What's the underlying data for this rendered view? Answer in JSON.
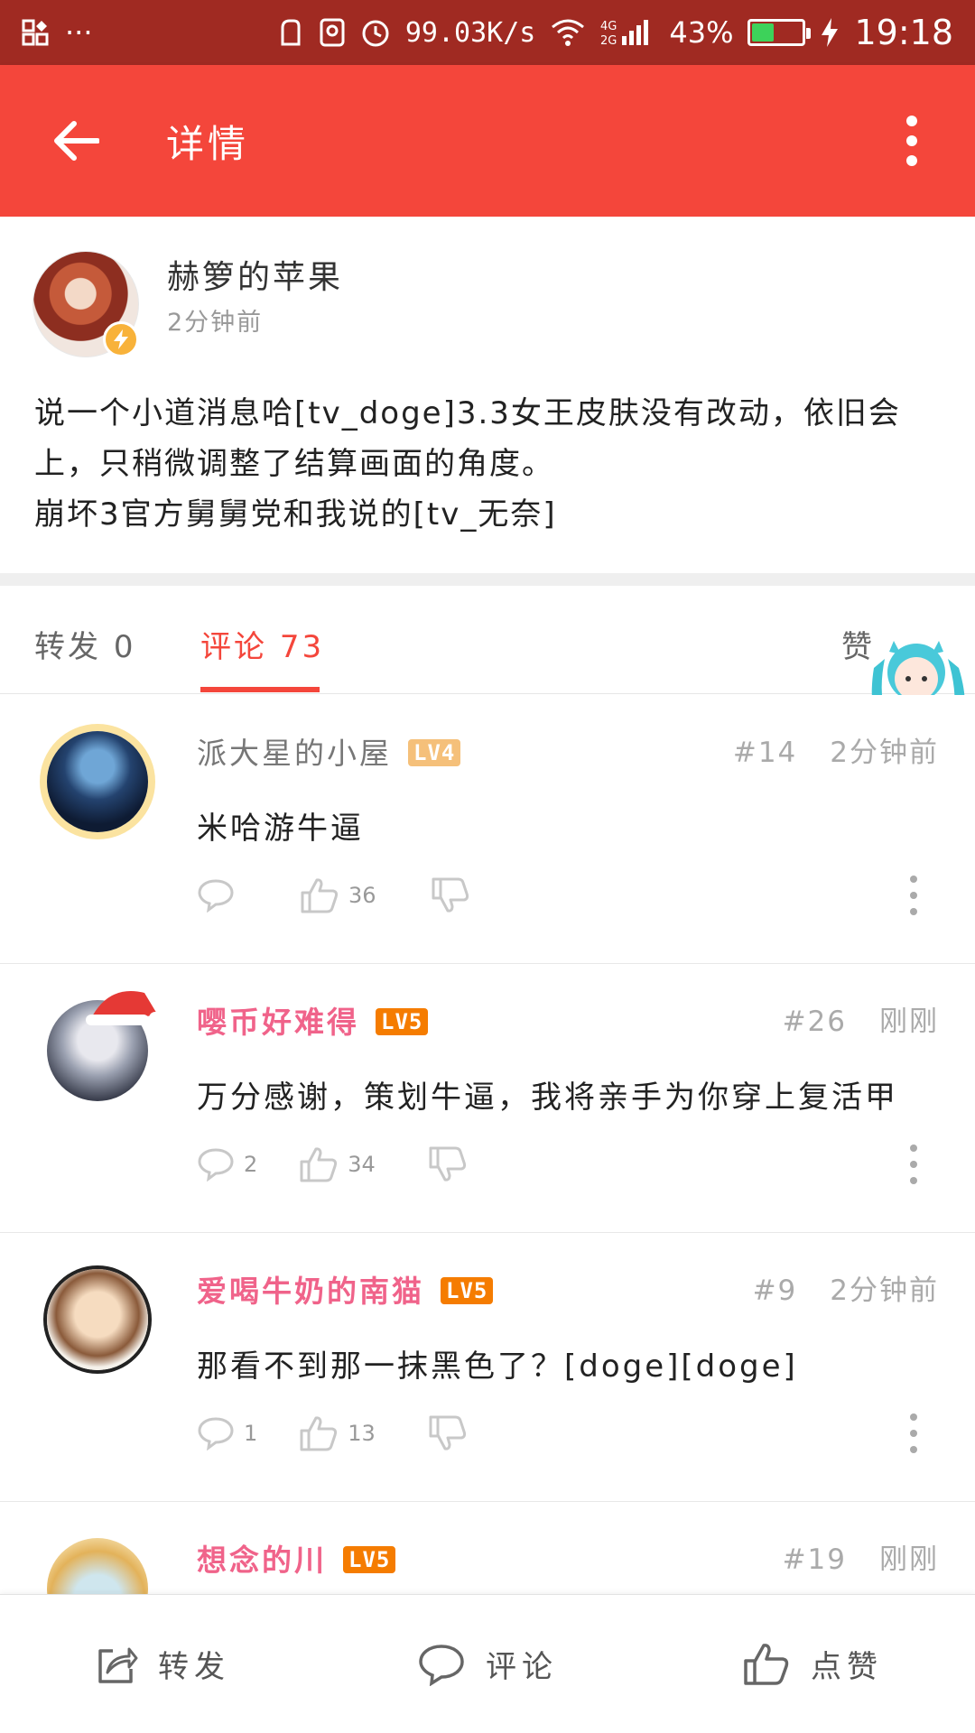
{
  "status_bar": {
    "network_speed": "99.03K/s",
    "signal_label": "4G 2G",
    "battery_percent": "43%",
    "battery_level": 0.43,
    "time": "19:18",
    "overflow": "···"
  },
  "app_bar": {
    "title": "详情",
    "background": "#f4463b"
  },
  "post": {
    "author": "赫箩的苹果",
    "time": "2分钟前",
    "text": "说一个小道消息哈[tv_doge]3.3女王皮肤没有改动，依旧会\n上，只稍微调整了结算画面的角度。\n崩坏3官方舅舅党和我说的[tv_无奈]"
  },
  "tabs": {
    "repost_label": "转发",
    "repost_count": "0",
    "comment_label": "评论",
    "comment_count": "73",
    "like_label": "赞"
  },
  "comments": [
    {
      "name": "派大星的小屋",
      "level": "LV4",
      "floor": "#14",
      "time": "2分钟前",
      "text": "米哈游牛逼",
      "reply_count": "",
      "like_count": "36"
    },
    {
      "name": "嘤币好难得",
      "level": "LV5",
      "floor": "#26",
      "time": "刚刚",
      "text": "万分感谢，策划牛逼，我将亲手为你穿上复活甲",
      "reply_count": "2",
      "like_count": "34"
    },
    {
      "name": "爱喝牛奶的南猫",
      "level": "LV5",
      "floor": "#9",
      "time": "2分钟前",
      "text": "那看不到那一抹黑色了？[doge][doge]",
      "reply_count": "1",
      "like_count": "13"
    },
    {
      "name": "想念的川",
      "level": "LV5",
      "floor": "#19",
      "time": "刚刚",
      "text": "",
      "reply_count": "",
      "like_count": ""
    }
  ],
  "bottom_bar": {
    "repost": "转发",
    "comment": "评论",
    "like": "点赞"
  },
  "icons": {
    "back": "arrow-left-icon",
    "more": "more-vertical-icon",
    "reply": "comment-bubble-icon",
    "like": "thumb-up-icon",
    "dislike": "thumb-down-icon",
    "repost": "share-icon"
  }
}
